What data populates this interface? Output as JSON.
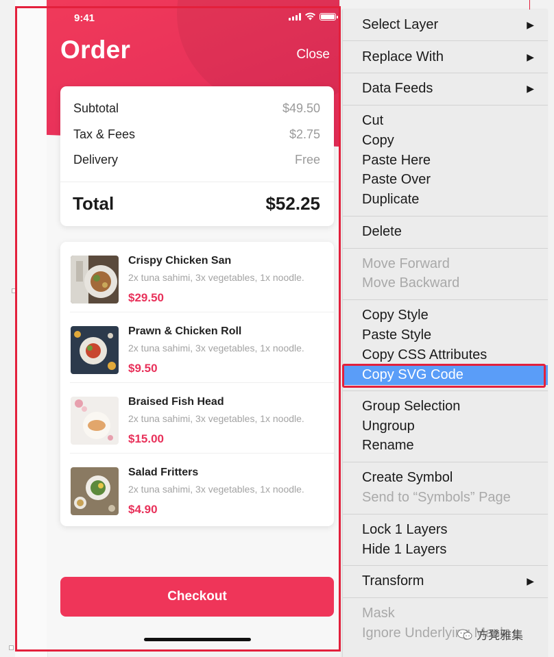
{
  "phone": {
    "status_time": "9:41",
    "title": "Order",
    "close_label": "Close",
    "summary": {
      "rows": [
        {
          "label": "Subtotal",
          "value": "$49.50"
        },
        {
          "label": "Tax & Fees",
          "value": "$2.75"
        },
        {
          "label": "Delivery",
          "value": "Free"
        }
      ],
      "total_label": "Total",
      "total_value": "$52.25"
    },
    "items": [
      {
        "name": "Crispy Chicken San",
        "desc": "2x tuna sahimi, 3x vegetables, 1x noodle.",
        "price": "$29.50"
      },
      {
        "name": "Prawn & Chicken Roll",
        "desc": "2x tuna sahimi, 3x vegetables, 1x noodle.",
        "price": "$9.50"
      },
      {
        "name": "Braised Fish Head",
        "desc": "2x tuna sahimi, 3x vegetables, 1x noodle.",
        "price": "$15.00"
      },
      {
        "name": "Salad Fritters",
        "desc": "2x tuna sahimi, 3x vegetables, 1x noodle.",
        "price": "$4.90"
      }
    ],
    "checkout_label": "Checkout"
  },
  "context_menu": {
    "groups": [
      [
        {
          "label": "Select Layer",
          "submenu": true
        }
      ],
      [
        {
          "label": "Replace With",
          "submenu": true
        }
      ],
      [
        {
          "label": "Data Feeds",
          "submenu": true
        }
      ],
      [
        {
          "label": "Cut"
        },
        {
          "label": "Copy"
        },
        {
          "label": "Paste Here"
        },
        {
          "label": "Paste Over"
        },
        {
          "label": "Duplicate"
        }
      ],
      [
        {
          "label": "Delete"
        }
      ],
      [
        {
          "label": "Move Forward",
          "disabled": true
        },
        {
          "label": "Move Backward",
          "disabled": true
        }
      ],
      [
        {
          "label": "Copy Style"
        },
        {
          "label": "Paste Style"
        },
        {
          "label": "Copy CSS Attributes"
        },
        {
          "label": "Copy SVG Code",
          "highlighted": true
        }
      ],
      [
        {
          "label": "Group Selection"
        },
        {
          "label": "Ungroup"
        },
        {
          "label": "Rename"
        }
      ],
      [
        {
          "label": "Create Symbol"
        },
        {
          "label": "Send to “Symbols” Page",
          "disabled": true
        }
      ],
      [
        {
          "label": "Lock 1 Layers"
        },
        {
          "label": "Hide 1 Layers"
        }
      ],
      [
        {
          "label": "Transform",
          "submenu": true
        }
      ],
      [
        {
          "label": "Mask",
          "disabled": true
        },
        {
          "label": "Ignore Underlying Mask",
          "disabled": true
        }
      ]
    ],
    "submenu_arrow": "▶"
  },
  "watermark": "方凳雅集",
  "colors": {
    "brand": "#ef3559",
    "price": "#e8315a",
    "menu_highlight": "#5a9df8",
    "annotation": "#e3203c"
  }
}
